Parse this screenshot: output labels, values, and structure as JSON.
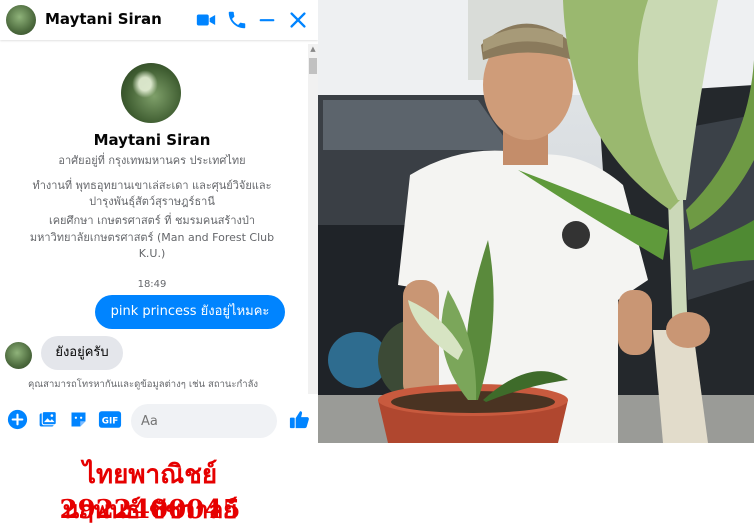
{
  "chat": {
    "header": {
      "name": "Maytani Siran"
    },
    "profile": {
      "name": "Maytani Siran",
      "lives_in": "อาศัยอยู่ที่ กรุงเทพมหานคร ประเทศไทย",
      "work_line1": "ทำงานที่ พุทธอุทยานเขาเล่สะเดา และศุนย์วิจัยและ",
      "work_line2": "ปารุงพันธุ์สัตว์สุราษฎร์ธานี",
      "study_line1": "เคยศึกษา เกษตรศาสตร์ ที่ ชมรมคนสร้างป่า",
      "study_line2": "มหาวิทยาลัยเกษตรศาสตร์ (Man and Forest Club",
      "study_line3": "K.U.)"
    },
    "timestamp": "18:49",
    "outgoing_message": "pink princess ยังอยู่ไหมคะ",
    "incoming_message": "ยังอยู่ครับ",
    "notice": "คุณสามารถโทรหากันและดูข้อมูลต่างๆ เช่น สถานะกำลัง",
    "composer": {
      "placeholder": "Aa",
      "gif_label": "GIF"
    },
    "accent_color": "#0084ff"
  },
  "photo": {},
  "caption": {
    "line1": "ไทยพาณิชย์ 2922400045",
    "line2": "นฤพนธ์ ชัชวาลย์",
    "color": "#e60000"
  }
}
